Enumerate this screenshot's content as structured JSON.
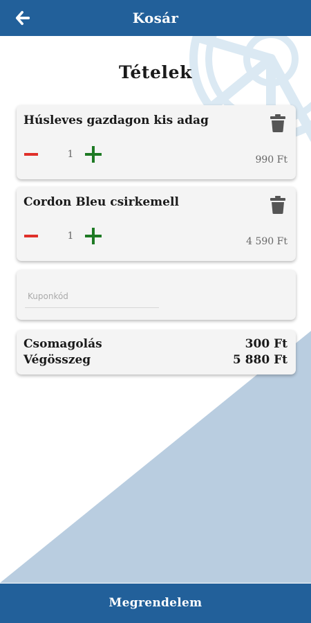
{
  "header": {
    "title": "Kosár",
    "back_icon": "arrow-left-icon",
    "background_color": "#22609a"
  },
  "section_title": "Tételek",
  "cart_items": [
    {
      "name": "Húsleves gazdagon kis adag",
      "quantity": "1",
      "price": "990 Ft",
      "delete_icon": "trash-icon",
      "decrease_icon": "minus-icon",
      "increase_icon": "plus-icon"
    },
    {
      "name": "Cordon Bleu csirkemell",
      "quantity": "1",
      "price": "4 590 Ft",
      "delete_icon": "trash-icon",
      "decrease_icon": "minus-icon",
      "increase_icon": "plus-icon"
    }
  ],
  "coupon": {
    "placeholder": "Kuponkód",
    "value": ""
  },
  "summary": {
    "packaging_label": "Csomagolás",
    "packaging_value": "300 Ft",
    "total_label": "Végösszeg",
    "total_value": "5 880 Ft"
  },
  "order_button": {
    "label": "Megrendelem"
  },
  "colors": {
    "accent_blue": "#22609a",
    "minus_red": "#e0302a",
    "plus_green": "#1e7a24",
    "background_diagonal": "#b9cde0",
    "watermark": "#dbe9f3",
    "card": "#f4f4f4"
  }
}
